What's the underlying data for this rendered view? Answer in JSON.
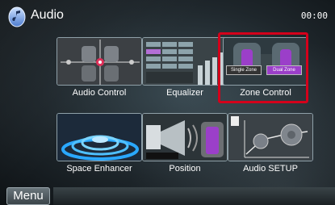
{
  "header": {
    "title": "Audio",
    "clock": "00:00",
    "logo_icon": "audio-app-icon"
  },
  "tiles": [
    {
      "label": "Audio Control",
      "icon": "seat-balance-icon"
    },
    {
      "label": "Equalizer",
      "icon": "equalizer-sliders-icon"
    },
    {
      "label": "Zone Control",
      "icon": "zone-seats-icon",
      "selected": true,
      "buttons": {
        "single": "Single Zone",
        "dual": "Dual Zone"
      }
    },
    {
      "label": "Space Enhancer",
      "icon": "sound-rings-icon"
    },
    {
      "label": "Position",
      "icon": "listening-position-icon"
    },
    {
      "label": "Audio SETUP",
      "icon": "speaker-setup-icon"
    }
  ],
  "footer": {
    "menu_label": "Menu"
  },
  "colors": {
    "selection": "#d4001b",
    "accent_purple": "#9b3fc9",
    "accent_blue": "#2aa8ff"
  }
}
